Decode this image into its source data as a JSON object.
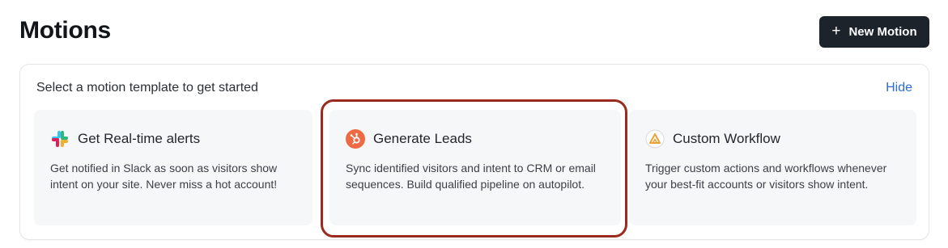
{
  "header": {
    "title": "Motions",
    "new_button_label": "New Motion",
    "new_button_icon": "plus-icon"
  },
  "templates_panel": {
    "heading": "Select a motion template to get started",
    "hide_label": "Hide",
    "cards": [
      {
        "title": "Get Real-time alerts",
        "description": "Get notified in Slack as soon as visitors show intent on your site. Never miss a hot account!",
        "icon": "slack-icon"
      },
      {
        "title": "Generate Leads",
        "description": "Sync identified visitors and intent to CRM or email sequences. Build qualified pipeline on autopilot.",
        "icon": "hubspot-icon"
      },
      {
        "title": "Custom Workflow",
        "description": "Trigger custom actions and workflows whenever your best-fit accounts or visitors show intent.",
        "icon": "workflow-logo-icon"
      }
    ]
  },
  "colors": {
    "button_bg": "#1d232b",
    "link": "#2c6bd8",
    "card_bg": "#f6f7f9",
    "highlight_border": "#9b2a1f",
    "hubspot_orange": "#ee6a44"
  }
}
